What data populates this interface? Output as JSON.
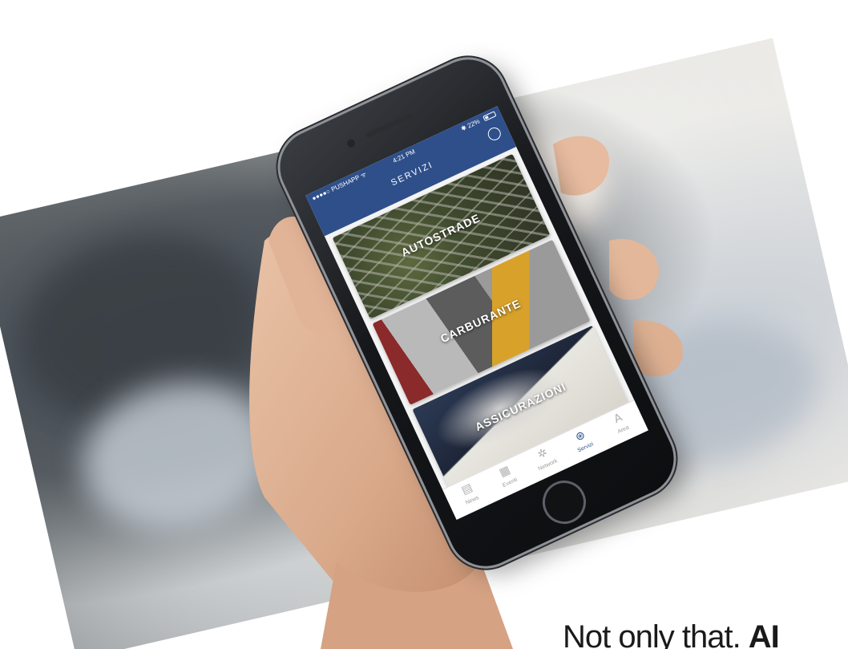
{
  "phone_screen": {
    "status": {
      "carrier": "●●●●○ PUSHAPP ᯤ",
      "time": "4:21 PM",
      "battery": "✱ 22%"
    },
    "title": "SERVIZI",
    "cards": [
      {
        "label": "AUTOSTRADE"
      },
      {
        "label": "CARBURANTE"
      },
      {
        "label": "ASSICURAZIONI"
      }
    ],
    "tabs": [
      {
        "label": "News",
        "icon": "newspaper-icon"
      },
      {
        "label": "Eventi",
        "icon": "calendar-icon"
      },
      {
        "label": "Network",
        "icon": "network-icon"
      },
      {
        "label": "Servizi",
        "icon": "services-icon"
      },
      {
        "label": "Area",
        "icon": "area-icon"
      }
    ],
    "tab_glyphs": [
      "▤",
      "▦",
      "✲",
      "⊛",
      "A"
    ],
    "accent_color": "#2e4f8a"
  },
  "caption": {
    "text_regular": "Not only that. ",
    "text_bold": "AI"
  }
}
